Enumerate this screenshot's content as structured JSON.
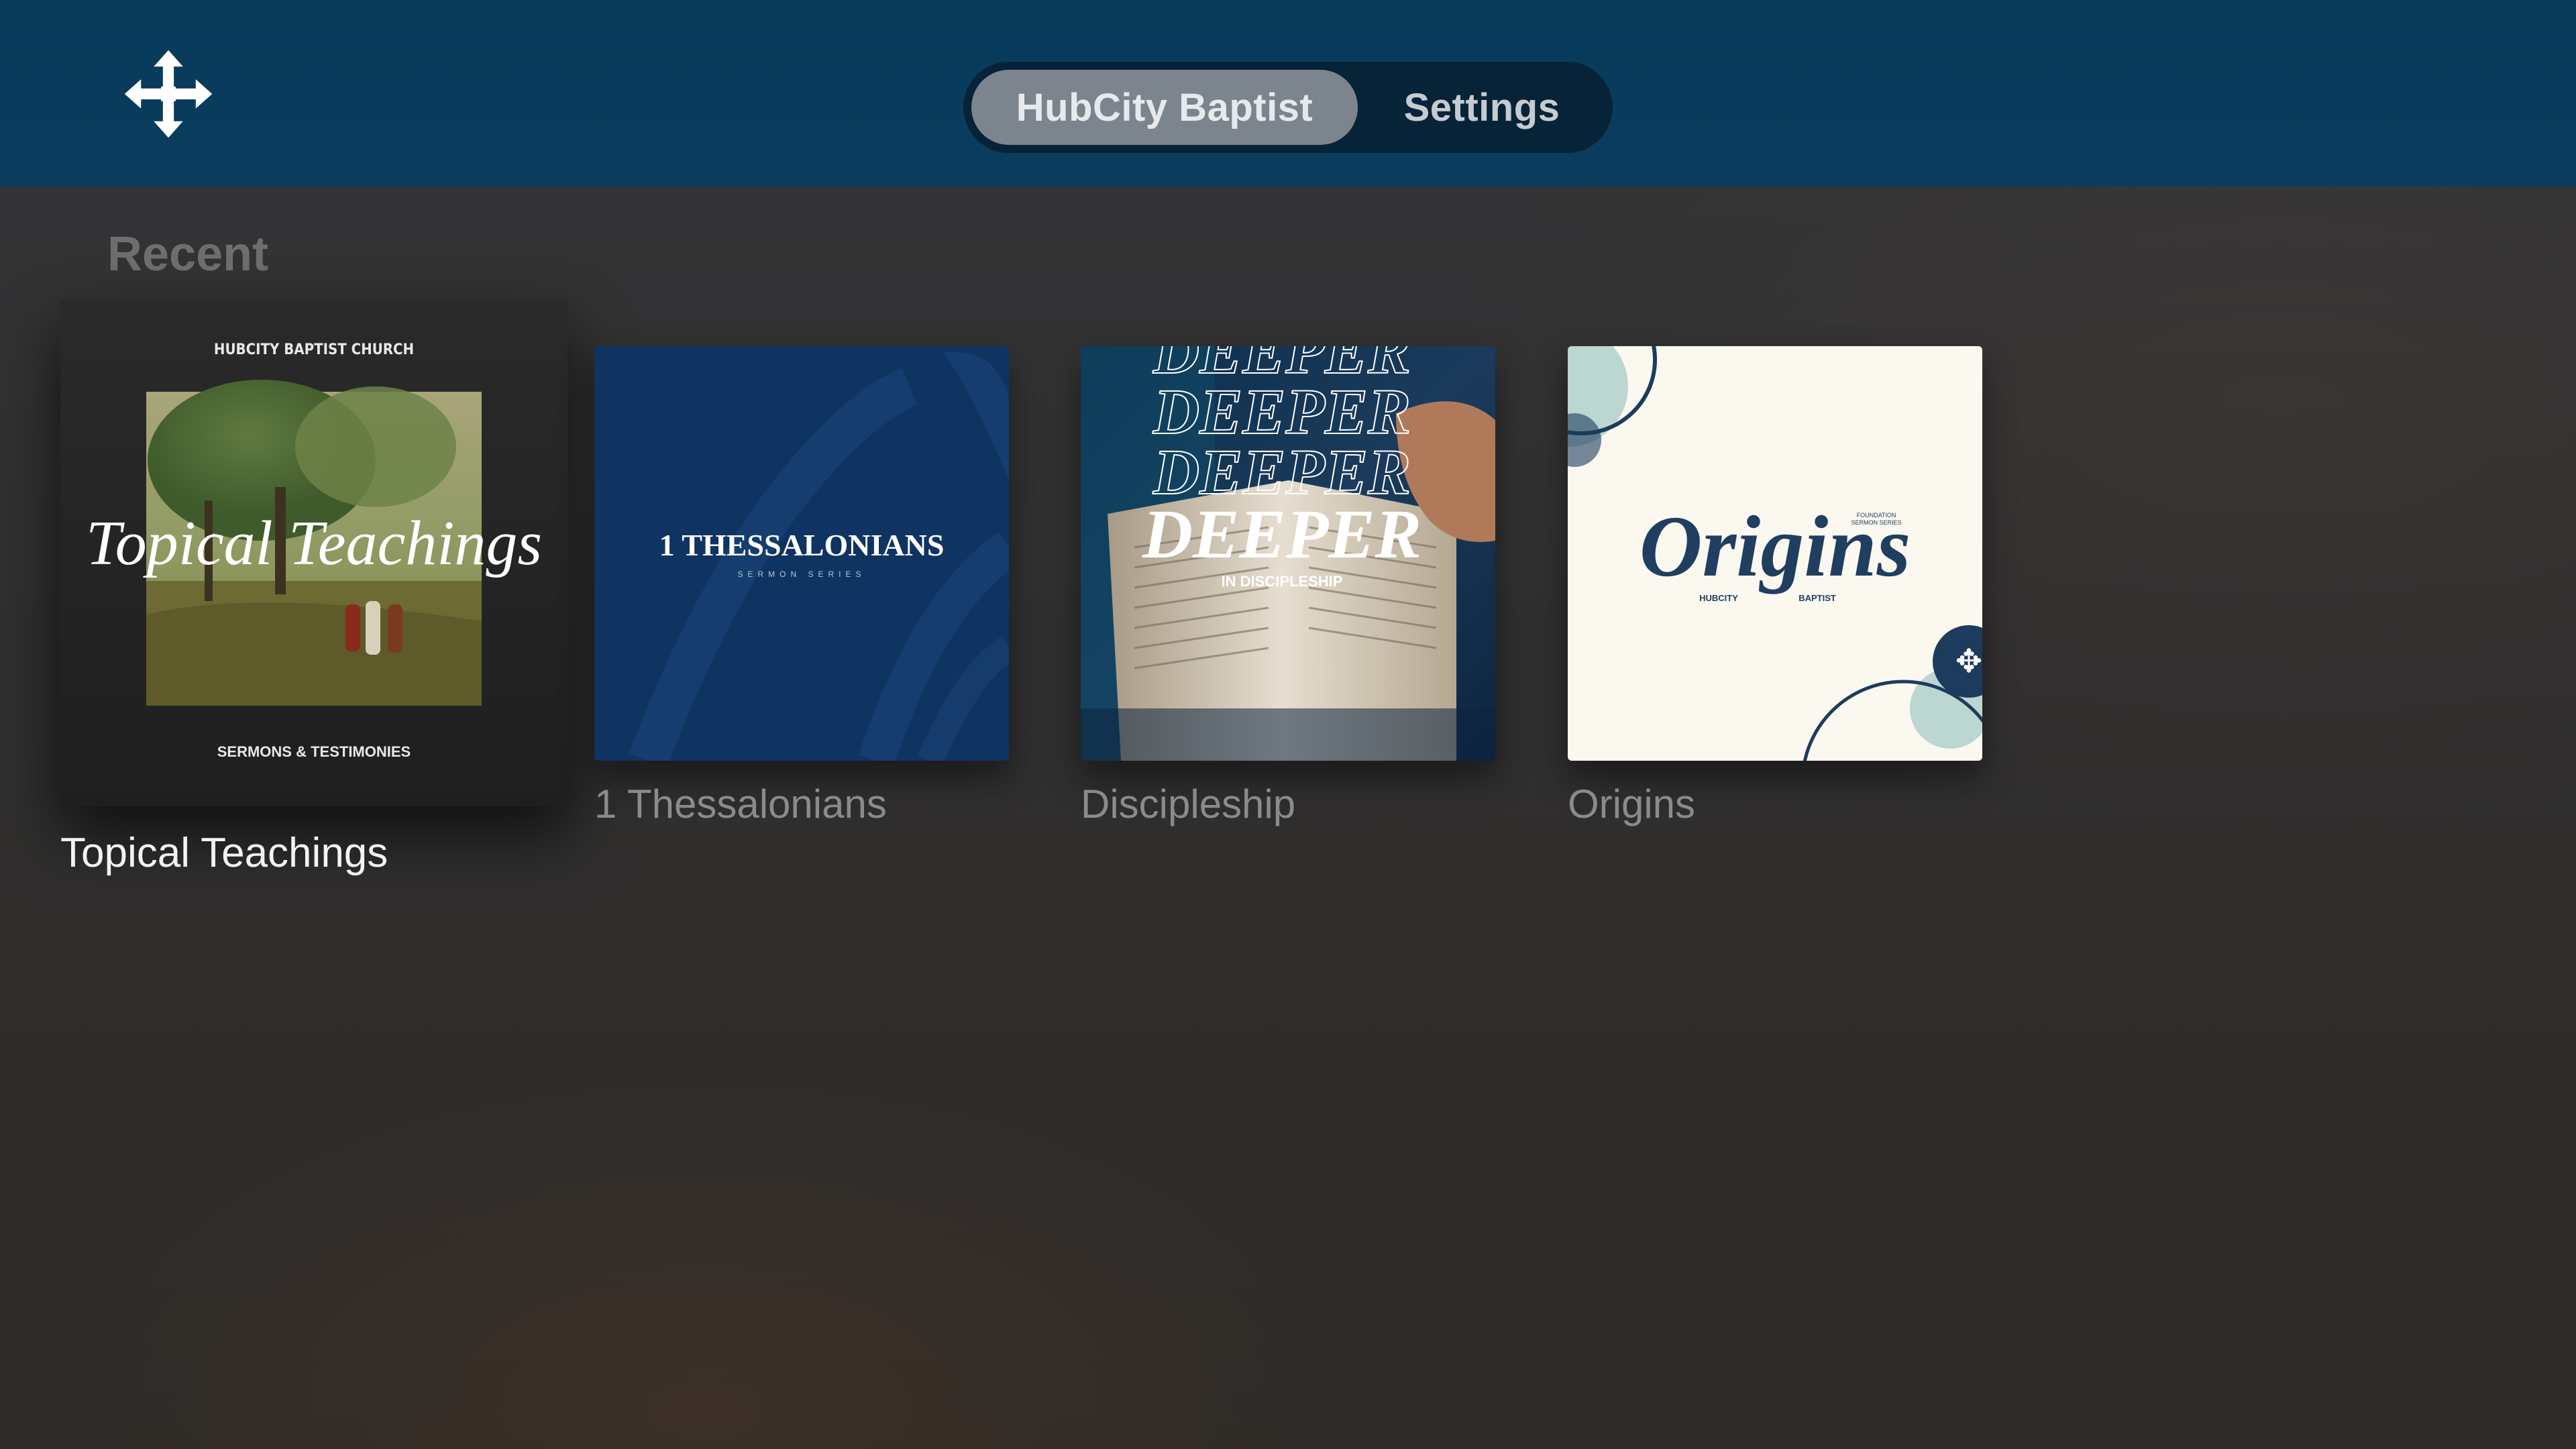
{
  "header": {
    "logo_icon": "hubcity-cross-arrows-icon",
    "tabs": [
      {
        "label": "HubCity Baptist",
        "selected": true
      },
      {
        "label": "Settings",
        "selected": false
      }
    ]
  },
  "main": {
    "section_title": "Recent",
    "items": [
      {
        "label": "Topical Teachings",
        "focused": true,
        "artwork": {
          "top_text": "HUBCITY BAPTIST CHURCH",
          "title": "Topical Teachings",
          "bottom_text": "SERMONS & TESTIMONIES"
        }
      },
      {
        "label": "1 Thessalonians",
        "focused": false,
        "artwork": {
          "title": "1 THESSALONIANS",
          "subtitle": "SERMON SERIES"
        }
      },
      {
        "label": "Discipleship",
        "focused": false,
        "artwork": {
          "echo": "DEEPER",
          "title": "DEEPER",
          "subtitle": "IN DISCIPLESHIP"
        }
      },
      {
        "label": "Origins",
        "focused": false,
        "artwork": {
          "title": "Origins",
          "left_text": "HUBCITY",
          "right_text": "BAPTIST",
          "corner_line1": "FOUNDATION",
          "corner_line2": "SERMON SERIES"
        }
      }
    ]
  },
  "colors": {
    "header_bg": "#0a3d5e",
    "tab_selected_bg": "#7c858d",
    "tabbar_bg": "#072337",
    "focused_label": "#f3f3f3",
    "unfocused_label": "#8b8b8c"
  }
}
